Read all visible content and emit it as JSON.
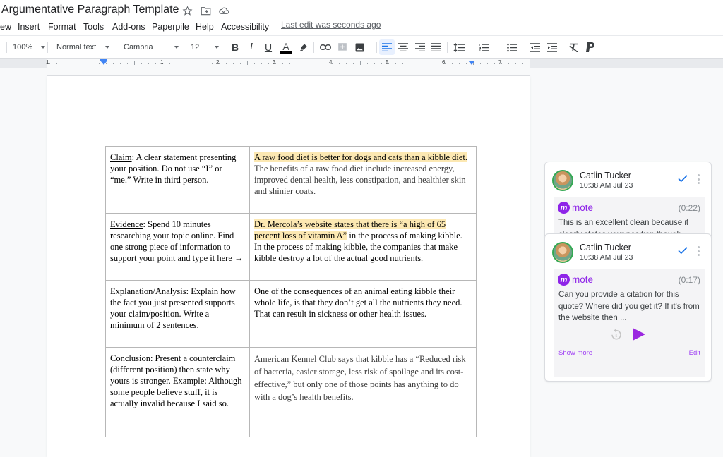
{
  "app": {
    "doc_title": "Argumentative Paragraph Template",
    "title_icons": [
      "star-icon",
      "move-to-folder-icon",
      "cloud-saved-icon"
    ]
  },
  "menu": {
    "items": [
      "ew",
      "Insert",
      "Format",
      "Tools",
      "Add-ons",
      "Paperpile",
      "Help",
      "Accessibility"
    ],
    "last_edit": "Last edit was seconds ago"
  },
  "toolbar": {
    "zoom": "100%",
    "style": "Normal text",
    "font": "Cambria",
    "font_size": "12",
    "buttons": [
      "bold",
      "italic",
      "underline",
      "text-color",
      "highlight",
      "link",
      "comment",
      "image",
      "align-left",
      "align-center",
      "align-right",
      "justify",
      "line-spacing",
      "numbered-list",
      "bulleted-list",
      "decrease-indent",
      "increase-indent",
      "clear-formatting",
      "paperpile"
    ],
    "bold_label": "B",
    "italic_label": "I",
    "underline_label": "U",
    "text_color_label": "A",
    "text_color": "#000000",
    "active_alignment": "align-left"
  },
  "ruler": {
    "labels": [
      "1",
      "1",
      "2",
      "3",
      "4",
      "5",
      "6",
      "7"
    ]
  },
  "table": {
    "rows": [
      {
        "label": "Claim",
        "instruction": ": A clear statement presenting your position. Do not use “I” or “me.” Write in third person.",
        "highlighted": "A raw food diet is better for dogs and cats than a kibble diet.",
        "response": " The benefits of a raw food diet include increased energy, improved dental health, less constipation, and healthier skin and shinier coats."
      },
      {
        "label": "Evidence",
        "instruction": ": Spend 10 minutes researching your topic online. Find one strong piece of information to support your point and type it here →",
        "highlighted": "Dr. Mercola’s website states that there is “a high of 65 percent loss of vitamin A”",
        "response": " in the process of making kibble. In the process of making kibble, the companies that make kibble destroy a lot of the actual good nutrients."
      },
      {
        "label": "Explanation/Analysis",
        "instruction": ": Explain how the fact you just presented supports your claim/position. Write a minimum of 2 sentences.",
        "highlighted": "",
        "response": " One of the consequences of an animal eating kibble their whole life, is that they don’t get all the nutrients they need. That can result in sickness or other health issues."
      },
      {
        "label": "Conclusion",
        "instruction": ": Present a counterclaim (different position) then state why yours is stronger. Example: Although some people believe stuff, it is actually invalid because I said so.",
        "highlighted": "",
        "response": "American Kennel Club says that kibble has a “Reduced risk of bacteria, easier storage, less risk of spoilage and its cost-effective,” but only one of those points has anything to do with a dog’s health benefits."
      }
    ],
    "highlight_color": "#fce8b2"
  },
  "comments": [
    {
      "author": "Catlin Tucker",
      "time": "10:38 AM Jul 23",
      "brand": "mote",
      "duration": "(0:22)",
      "text": "This is an excellent clean because it clearly states your position though..."
    },
    {
      "author": "Catlin Tucker",
      "time": "10:38 AM Jul 23",
      "brand": "mote",
      "duration": "(0:17)",
      "text": "Can you provide a citation for this quote? Where did you get it? If it's from the website then ...",
      "show_more": "Show more",
      "edit": "Edit"
    }
  ],
  "colors": {
    "accent_blue": "#4285f4",
    "mote_purple": "#8e24e8",
    "resolve_check": "#1a73e8"
  }
}
